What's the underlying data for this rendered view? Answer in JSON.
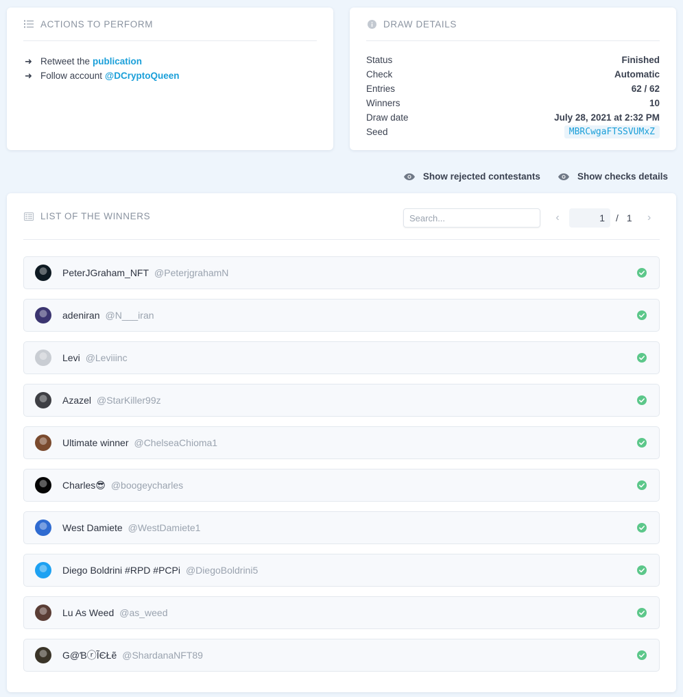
{
  "actions": {
    "title": "Actions to perform",
    "items": [
      {
        "text": "Retweet the",
        "link": "publication"
      },
      {
        "text": "Follow account",
        "link": "@DCryptoQueen"
      }
    ]
  },
  "details": {
    "title": "Draw details",
    "rows": [
      {
        "label": "Status",
        "value": "Finished"
      },
      {
        "label": "Check",
        "value": "Automatic"
      },
      {
        "label": "Entries",
        "value": "62 / 62"
      },
      {
        "label": "Winners",
        "value": "10"
      },
      {
        "label": "Draw date",
        "value": "July 28, 2021 at 2:32 PM"
      }
    ],
    "seed_label": "Seed",
    "seed_value": "MBRCwgaFTSSVUMxZ"
  },
  "toggles": {
    "rejected": "Show rejected contestants",
    "checks": "Show checks details"
  },
  "winners": {
    "title": "List of the winners",
    "search_placeholder": "Search...",
    "page": "1",
    "page_sep": "/",
    "total_pages": "1",
    "rows": [
      {
        "name": "PeterJGraham_NFT",
        "handle": "@PeterjgrahamN",
        "avatar_color": "#0e1a22"
      },
      {
        "name": "adeniran",
        "handle": "@N___iran",
        "avatar_color": "#3b3570"
      },
      {
        "name": "Levi",
        "handle": "@Leviiinc",
        "avatar_color": "#c9cdd3"
      },
      {
        "name": "Azazel",
        "handle": "@StarKiller99z",
        "avatar_color": "#3e3f44"
      },
      {
        "name": "Ultimate winner",
        "handle": "@ChelseaChioma1",
        "avatar_color": "#7a4a2e"
      },
      {
        "name": "Charles😎",
        "handle": "@boogeycharles",
        "avatar_color": "#050505"
      },
      {
        "name": "West Damiete",
        "handle": "@WestDamiete1",
        "avatar_color": "#2f6bd1"
      },
      {
        "name": "Diego Boldrini #RPD #PCPi",
        "handle": "@DiegoBoldrini5",
        "avatar_color": "#1da1f2"
      },
      {
        "name": "Lu As Weed",
        "handle": "@as_weed",
        "avatar_color": "#5a3d35"
      },
      {
        "name": "G@ƁⓡĨЄŁẽ",
        "handle": "@ShardanaNFT89",
        "avatar_color": "#3a3428"
      }
    ]
  },
  "colors": {
    "accent": "#1a9fd9",
    "check": "#5cc78a",
    "background": "#eef5fc"
  }
}
